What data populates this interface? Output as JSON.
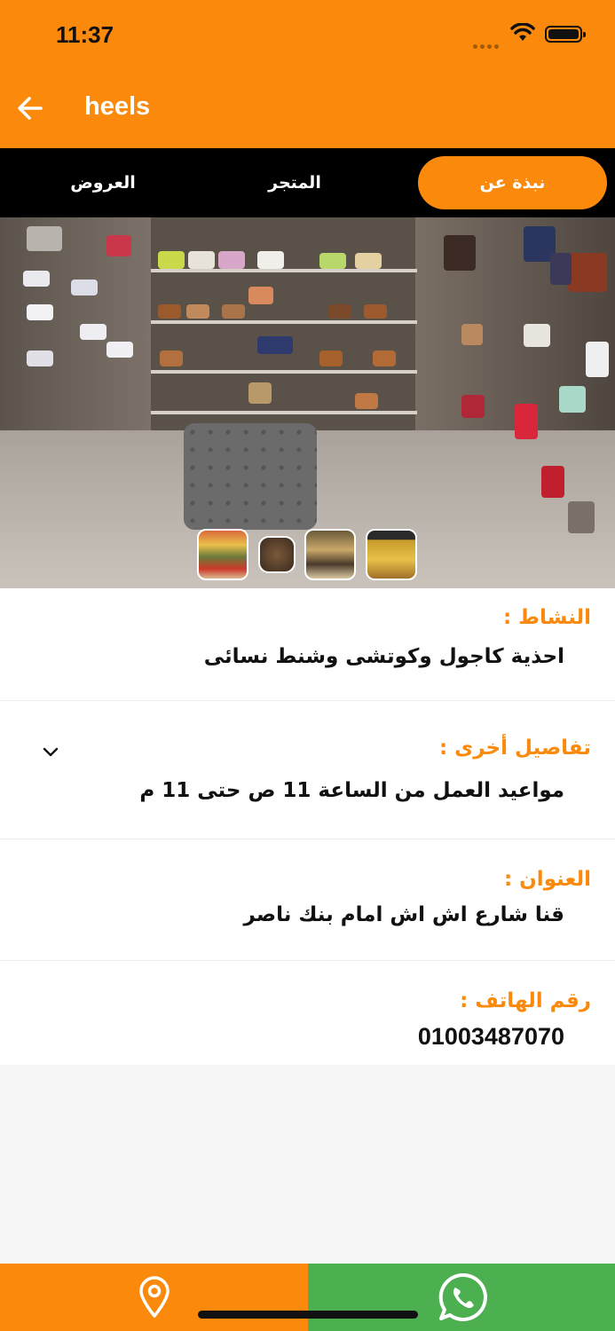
{
  "status_bar": {
    "time": "11:37"
  },
  "header": {
    "title": "heels",
    "back_icon": "arrow-left-icon"
  },
  "tabs": [
    {
      "label": "نبذة عن",
      "active": true
    },
    {
      "label": "المتجر",
      "active": false
    },
    {
      "label": "العروض",
      "active": false
    }
  ],
  "gallery": {
    "thumbnail_count": 4
  },
  "details": {
    "activity": {
      "label": "النشاط :",
      "value": "احذية كاجول وكوتشى  وشنط نسائى"
    },
    "other": {
      "label": "تفاصيل أخرى :",
      "value": "مواعيد العمل من الساعة 11 ص حتى 11 م"
    },
    "address": {
      "label": "العنوان :",
      "value": "قنا شارع اش اش امام بنك ناصر"
    },
    "phone": {
      "label": "رقم الهاتف :",
      "value": "01003487070"
    }
  },
  "bottom_bar": {
    "left_icon": "location-pin-icon",
    "right_icon": "whatsapp-icon"
  },
  "colors": {
    "accent": "#fb8a0c",
    "whatsapp": "#4caf50",
    "tab_bar": "#000000"
  }
}
